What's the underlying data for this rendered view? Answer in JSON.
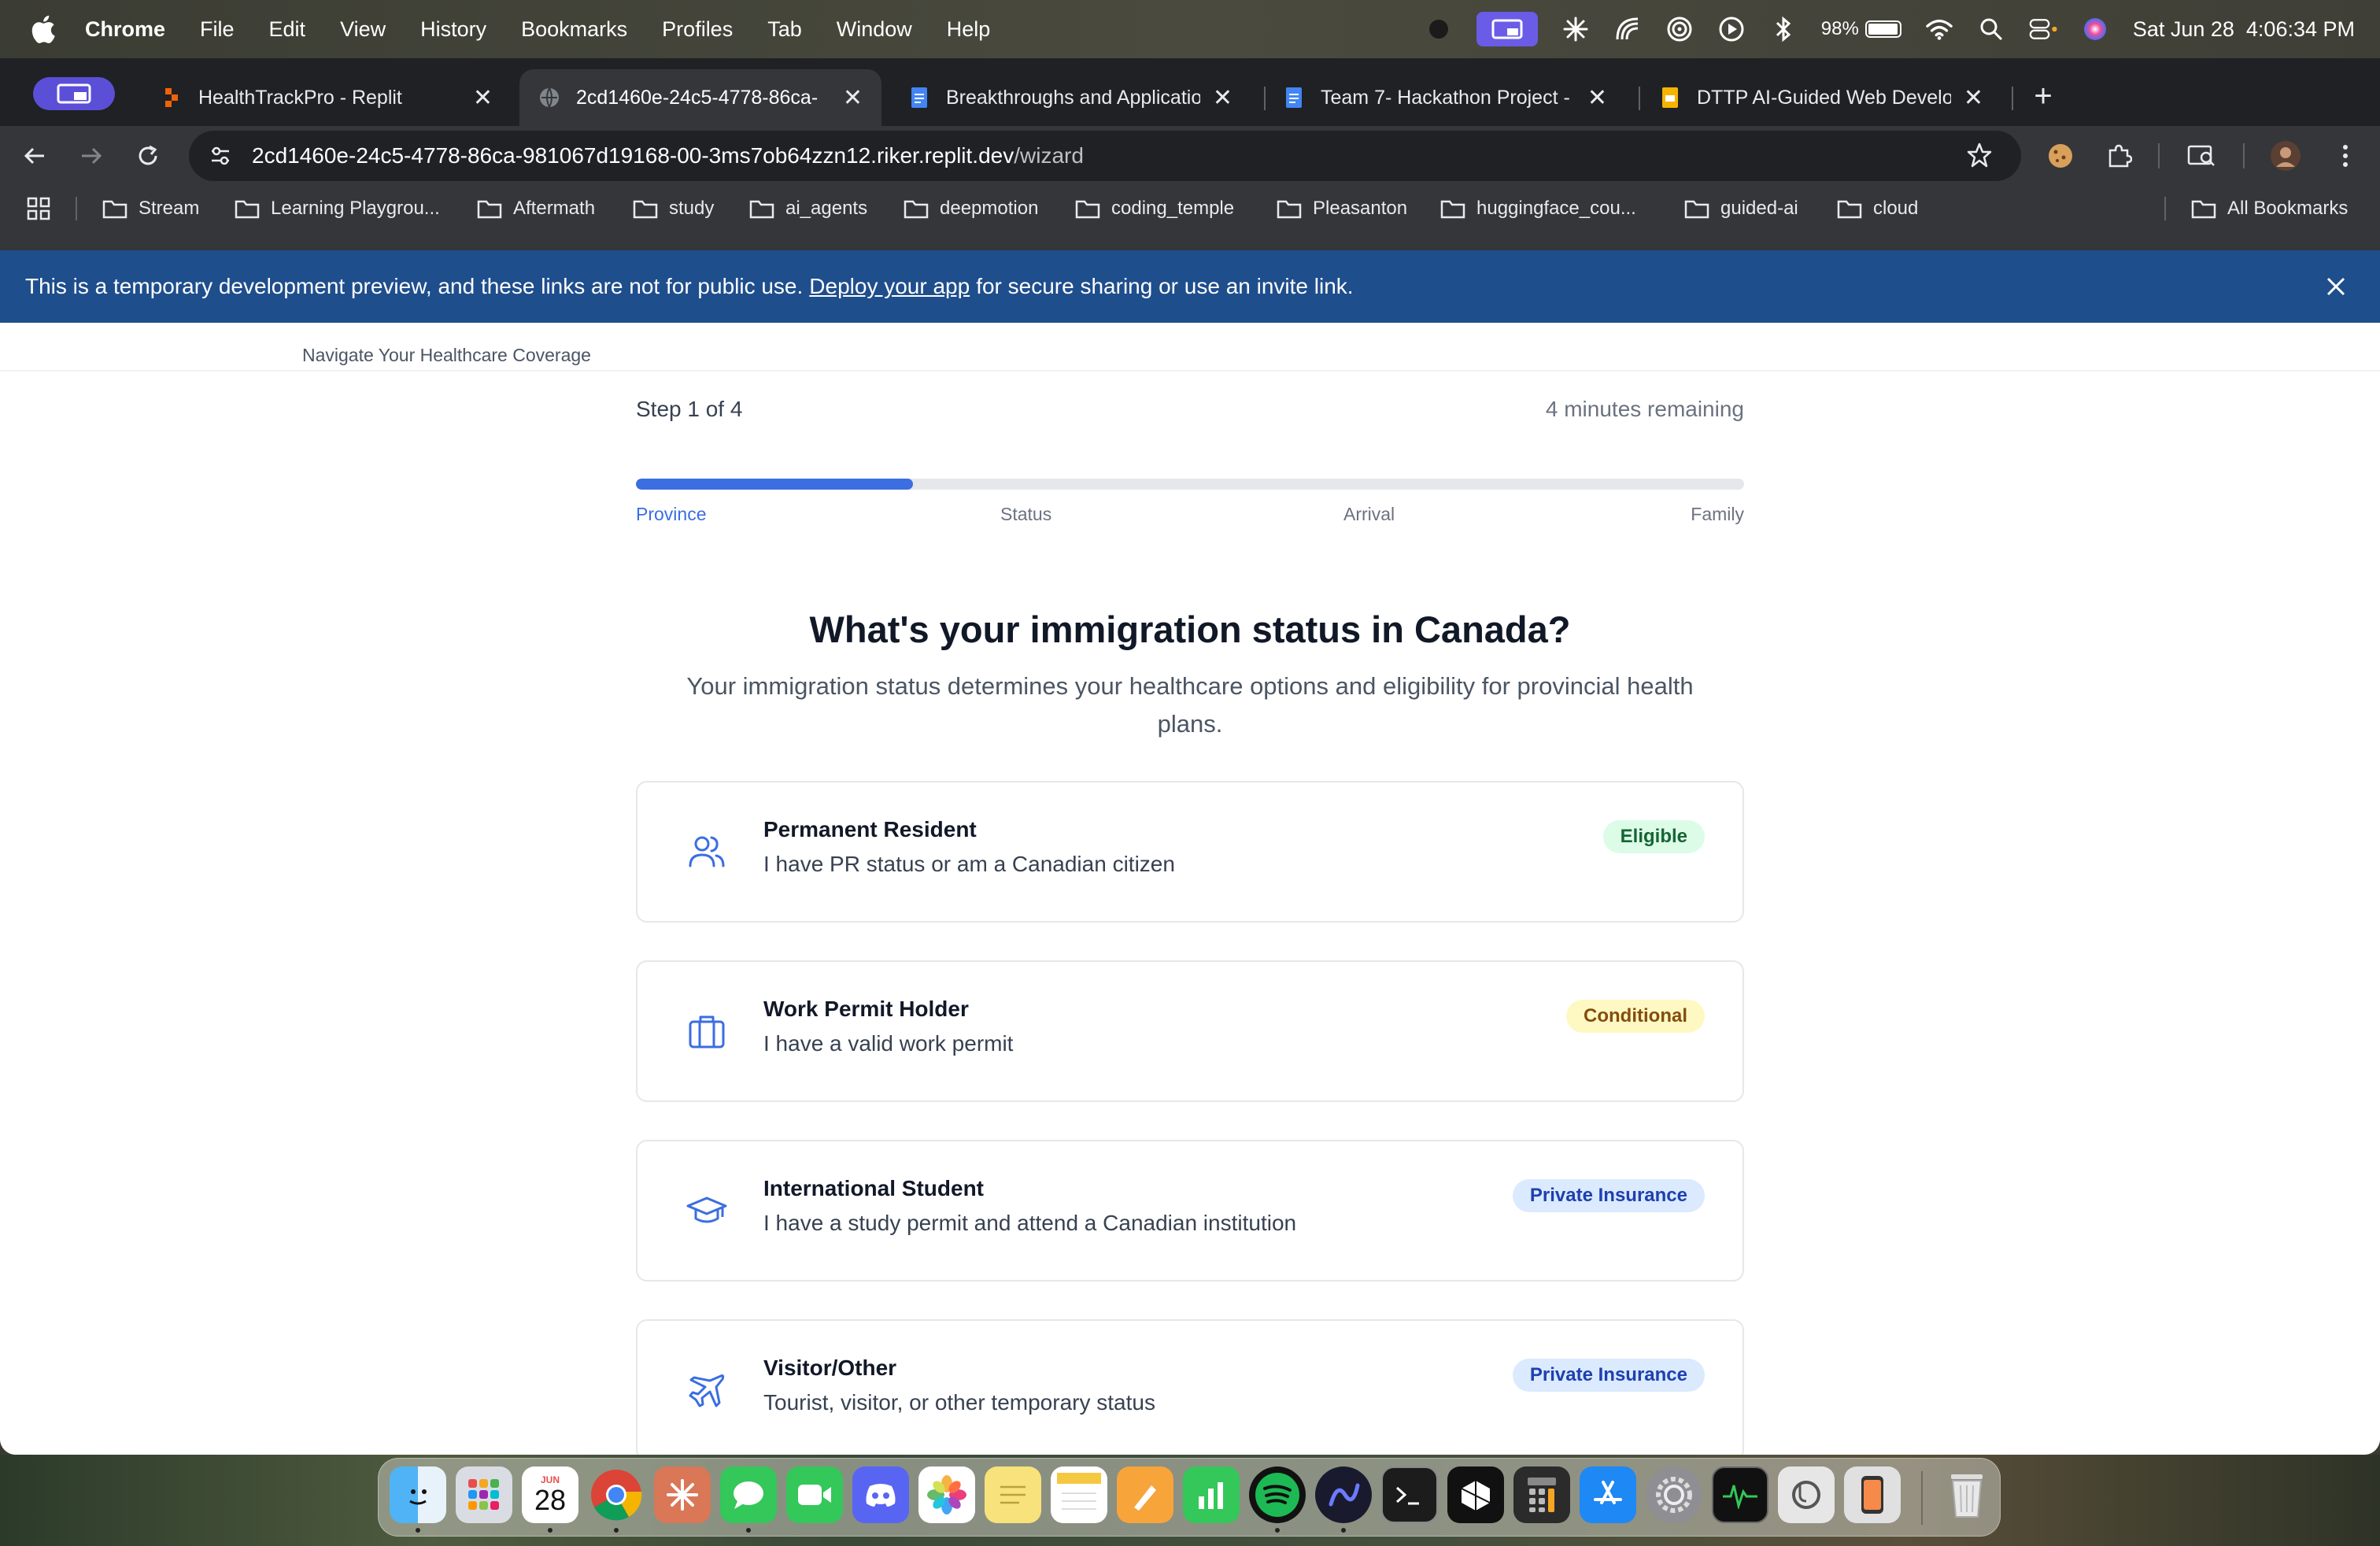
{
  "menubar": {
    "app_name": "Chrome",
    "menus": [
      "File",
      "Edit",
      "View",
      "History",
      "Bookmarks",
      "Profiles",
      "Tab",
      "Window",
      "Help"
    ],
    "battery_percent": "98%",
    "datetime": "Sat Jun 28  4:06:34 PM"
  },
  "tabs": [
    {
      "title": "HealthTrackPro - Replit",
      "active": false
    },
    {
      "title": "2cd1460e-24c5-4778-86ca-",
      "active": true
    },
    {
      "title": "Breakthroughs and Applicatio",
      "active": false
    },
    {
      "title": "Team 7- Hackathon Project - ",
      "active": false
    },
    {
      "title": "DTTP AI-Guided Web Develop",
      "active": false
    }
  ],
  "address_bar": {
    "host": "2cd1460e-24c5-4778-86ca-981067d19168-00-3ms7ob64zzn12.riker.replit.dev",
    "path": "/wizard"
  },
  "bookmarks": [
    "Stream",
    "Learning Playgrou...",
    "Aftermath",
    "study",
    "ai_agents",
    "deepmotion",
    "coding_temple",
    "Pleasanton",
    "huggingface_cou...",
    "guided-ai",
    "cloud"
  ],
  "all_bookmarks_label": "All Bookmarks",
  "dev_banner": {
    "prefix": "This is a temporary development preview, and these links are not for public use.",
    "link": "Deploy your app",
    "suffix": "for secure sharing or use an invite link."
  },
  "page": {
    "tagline": "Navigate Your Healthcare Coverage",
    "step_text": "Step 1 of 4",
    "remaining": "4 minutes remaining",
    "progress_fraction": 0.25,
    "steps": [
      "Province",
      "Status",
      "Arrival",
      "Family"
    ],
    "question": "What's your immigration status in Canada?",
    "description": "Your immigration status determines your healthcare options and eligibility for provincial health plans.",
    "options": [
      {
        "title": "Permanent Resident",
        "subtitle": "I have PR status or am a Canadian citizen",
        "badge": "Eligible",
        "badge_color": "green",
        "icon": "users-icon"
      },
      {
        "title": "Work Permit Holder",
        "subtitle": "I have a valid work permit",
        "badge": "Conditional",
        "badge_color": "yellow",
        "icon": "briefcase-icon"
      },
      {
        "title": "International Student",
        "subtitle": "I have a study permit and attend a Canadian institution",
        "badge": "Private Insurance",
        "badge_color": "blue",
        "icon": "graduation-cap-icon"
      },
      {
        "title": "Visitor/Other",
        "subtitle": "Tourist, visitor, or other temporary status",
        "badge": "Private Insurance",
        "badge_color": "blue",
        "icon": "plane-icon"
      }
    ]
  },
  "dock": {
    "calendar_month": "JUN",
    "calendar_day": "28"
  },
  "colors": {
    "accent": "#3b6ee0",
    "banner": "#1f4e8c",
    "tabstrip": "#202124",
    "toolbar": "#35363a"
  }
}
